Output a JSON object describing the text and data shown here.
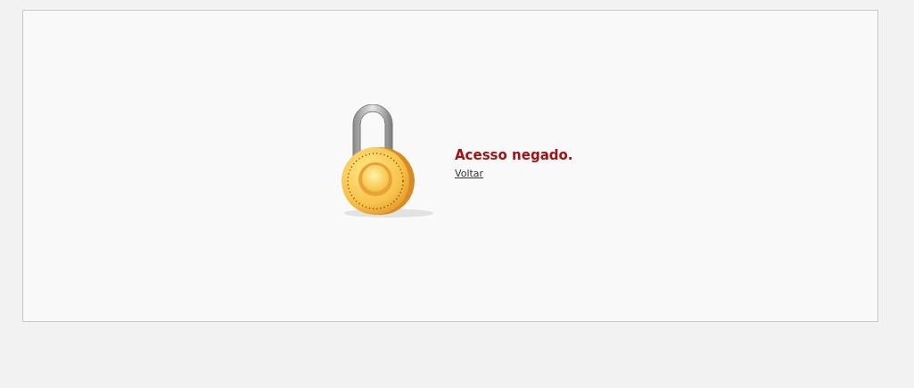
{
  "message": {
    "title": "Acesso negado.",
    "link": "Voltar"
  }
}
